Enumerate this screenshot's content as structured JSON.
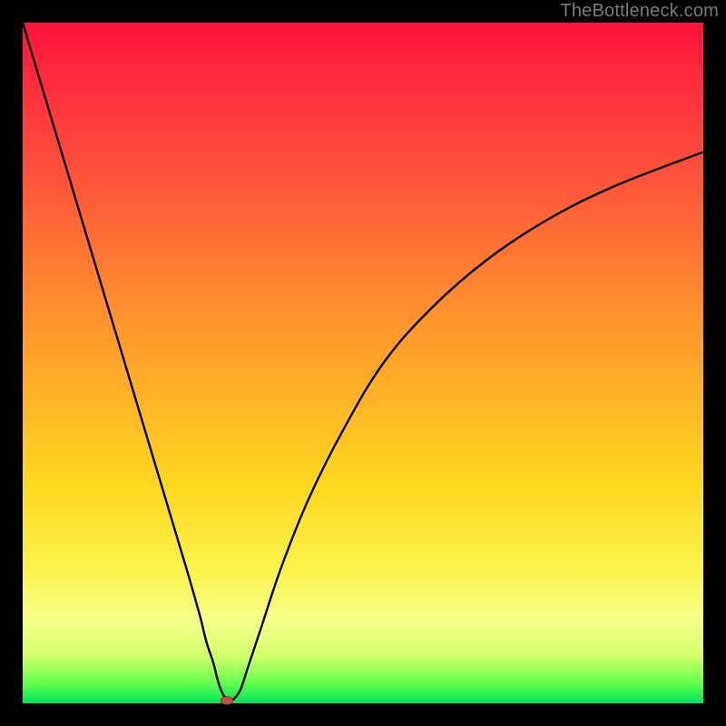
{
  "watermark": "TheBottleneck.com",
  "colors": {
    "frame": "#000000",
    "curve": "#000000",
    "marker_fill": "#c0514a",
    "marker_stroke": "#7a2f2a",
    "gradient_top": "#ff133a",
    "gradient_bottom": "#00e35a"
  },
  "chart_data": {
    "type": "line",
    "title": "",
    "xlabel": "",
    "ylabel": "",
    "xlim": [
      0,
      100
    ],
    "ylim": [
      0,
      100
    ],
    "grid": false,
    "legend": false,
    "annotations": [],
    "series": [
      {
        "name": "curve",
        "x": [
          0,
          3,
          6,
          9,
          12,
          15,
          18,
          21,
          24,
          26,
          27,
          28,
          28.5,
          29,
          29.5,
          30,
          30.5,
          31,
          32,
          33,
          35,
          38,
          42,
          47,
          53,
          60,
          68,
          77,
          87,
          100
        ],
        "y": [
          100,
          90,
          80,
          70,
          60,
          50,
          40,
          30,
          20,
          13,
          9,
          6,
          4,
          2.3,
          1.2,
          0.6,
          0.6,
          0.6,
          2,
          5,
          11,
          20,
          30,
          40,
          50,
          58,
          65,
          71,
          76,
          81
        ]
      }
    ],
    "marker": {
      "x": 30,
      "y": 0.4,
      "rx": 0.9,
      "ry": 0.6
    }
  }
}
